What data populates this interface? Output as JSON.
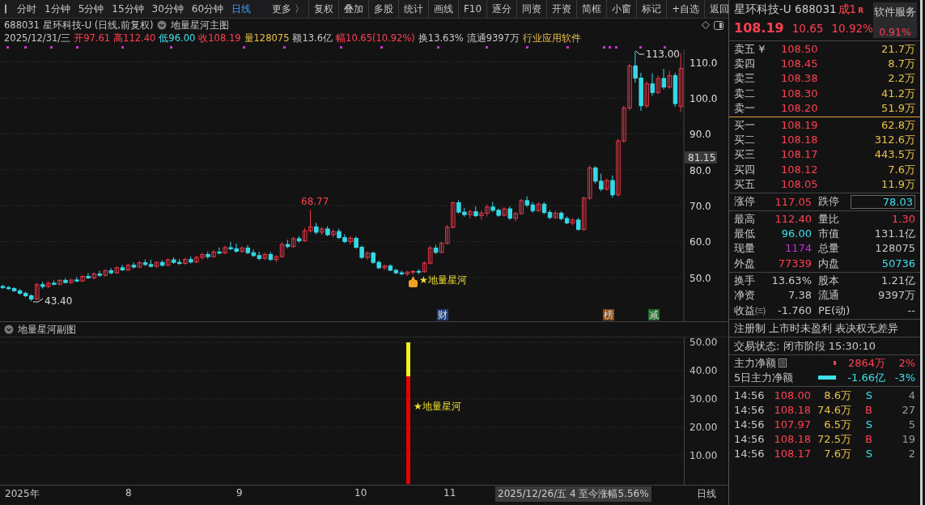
{
  "toolbar": {
    "period_tabs": [
      {
        "label": "分时",
        "selected": false
      },
      {
        "label": "1分钟",
        "selected": false
      },
      {
        "label": "5分钟",
        "selected": false
      },
      {
        "label": "15分钟",
        "selected": false
      },
      {
        "label": "30分钟",
        "selected": false
      },
      {
        "label": "60分钟",
        "selected": false
      },
      {
        "label": "日线",
        "selected": true
      },
      {
        "label": "更多 〉",
        "selected": false
      }
    ],
    "buttons": [
      "复权",
      "叠加",
      "多股",
      "统计",
      "画线",
      "F10",
      "逐分",
      "同资",
      "开资",
      "简框",
      "小窗",
      "标记",
      "+自选",
      "返回"
    ]
  },
  "header": {
    "title": "688031 星环科技-U (日线,前复权)",
    "indicator": "地量星河主图",
    "date": "2025/12/31/三",
    "quotes": [
      {
        "text": "开97.61",
        "kind": "up"
      },
      {
        "text": "高112.40",
        "kind": "up"
      },
      {
        "text": "低96.00",
        "kind": "down"
      },
      {
        "text": "收108.19",
        "kind": "up"
      },
      {
        "text": "量128075",
        "kind": "volume"
      },
      {
        "text": "额13.6亿",
        "kind": "plain"
      },
      {
        "text": "幅10.65(10.92%)",
        "kind": "up"
      },
      {
        "text": "换13.63%",
        "kind": "plain"
      },
      {
        "text": "流通9397万",
        "kind": "plain"
      },
      {
        "text": "行业应用软件",
        "kind": "volume"
      }
    ]
  },
  "main_chart": {
    "chart_data": {
      "type": "candlestick",
      "ohlc": [
        [
          47.5,
          48.0,
          46.8,
          47.2
        ],
        [
          47.2,
          47.6,
          46.5,
          46.9
        ],
        [
          46.9,
          47.3,
          46.0,
          46.3
        ],
        [
          46.3,
          46.8,
          45.2,
          45.6
        ],
        [
          45.6,
          46.0,
          44.5,
          44.9
        ],
        [
          44.9,
          45.3,
          43.4,
          44.0
        ],
        [
          44.0,
          48.5,
          43.8,
          48.0
        ],
        [
          48.0,
          48.8,
          46.9,
          47.5
        ],
        [
          47.5,
          48.9,
          47.0,
          48.4
        ],
        [
          48.4,
          49.2,
          47.8,
          48.1
        ],
        [
          48.1,
          49.5,
          47.9,
          49.2
        ],
        [
          49.2,
          49.8,
          48.3,
          48.6
        ],
        [
          48.6,
          49.6,
          48.2,
          49.3
        ],
        [
          49.3,
          50.1,
          48.7,
          49.0
        ],
        [
          49.0,
          50.6,
          48.8,
          50.3
        ],
        [
          50.3,
          51.2,
          49.6,
          49.9
        ],
        [
          49.9,
          51.4,
          49.5,
          51.0
        ],
        [
          51.0,
          51.9,
          50.2,
          50.6
        ],
        [
          50.6,
          52.3,
          50.3,
          51.9
        ],
        [
          51.9,
          52.6,
          50.9,
          51.3
        ],
        [
          51.3,
          53.1,
          51.0,
          52.7
        ],
        [
          52.7,
          53.5,
          51.8,
          52.1
        ],
        [
          52.1,
          53.8,
          51.7,
          53.4
        ],
        [
          53.4,
          54.2,
          52.5,
          52.9
        ],
        [
          52.9,
          54.6,
          52.6,
          54.1
        ],
        [
          54.1,
          55.0,
          53.2,
          53.6
        ],
        [
          53.6,
          54.9,
          52.8,
          53.1
        ],
        [
          53.1,
          54.5,
          52.7,
          54.2
        ],
        [
          54.2,
          54.8,
          53.0,
          53.4
        ],
        [
          53.4,
          55.3,
          53.1,
          54.9
        ],
        [
          54.9,
          55.6,
          53.8,
          54.2
        ],
        [
          54.2,
          55.1,
          53.5,
          53.9
        ],
        [
          53.9,
          55.4,
          53.6,
          55.0
        ],
        [
          55.0,
          55.8,
          53.9,
          54.3
        ],
        [
          54.3,
          56.0,
          54.0,
          55.6
        ],
        [
          55.6,
          56.9,
          55.0,
          56.4
        ],
        [
          56.4,
          57.2,
          55.2,
          55.8
        ],
        [
          55.8,
          57.6,
          55.5,
          57.1
        ],
        [
          57.1,
          58.3,
          56.4,
          56.8
        ],
        [
          56.8,
          58.8,
          56.5,
          58.3
        ],
        [
          58.3,
          59.9,
          57.6,
          58.0
        ],
        [
          58.0,
          59.4,
          56.9,
          57.3
        ],
        [
          57.3,
          58.7,
          56.8,
          58.2
        ],
        [
          58.2,
          59.0,
          56.5,
          56.9
        ],
        [
          56.9,
          57.8,
          55.7,
          56.1
        ],
        [
          56.1,
          57.2,
          54.8,
          55.3
        ],
        [
          55.3,
          56.9,
          54.9,
          56.4
        ],
        [
          56.4,
          57.1,
          54.6,
          55.0
        ],
        [
          55.0,
          56.2,
          54.3,
          55.8
        ],
        [
          55.8,
          59.8,
          55.5,
          59.2
        ],
        [
          59.2,
          60.5,
          58.1,
          58.6
        ],
        [
          58.6,
          61.3,
          58.3,
          60.8
        ],
        [
          60.8,
          61.5,
          59.7,
          60.2
        ],
        [
          60.2,
          63.8,
          59.9,
          63.0
        ],
        [
          63.0,
          68.77,
          62.5,
          64.1
        ],
        [
          64.1,
          65.2,
          62.0,
          62.6
        ],
        [
          62.6,
          64.0,
          61.8,
          63.5
        ],
        [
          63.5,
          64.3,
          61.5,
          61.9
        ],
        [
          61.9,
          63.4,
          61.2,
          62.8
        ],
        [
          62.8,
          63.6,
          60.7,
          61.1
        ],
        [
          61.1,
          62.0,
          59.6,
          60.0
        ],
        [
          60.0,
          61.5,
          59.2,
          60.9
        ],
        [
          60.9,
          61.4,
          58.0,
          58.4
        ],
        [
          58.4,
          58.9,
          55.2,
          55.6
        ],
        [
          55.6,
          57.3,
          54.9,
          56.8
        ],
        [
          56.8,
          57.2,
          53.8,
          54.2
        ],
        [
          54.2,
          54.7,
          52.3,
          52.7
        ],
        [
          52.7,
          53.6,
          52.1,
          53.2
        ],
        [
          53.2,
          53.7,
          51.8,
          52.0
        ],
        [
          52.0,
          52.4,
          50.9,
          51.3
        ],
        [
          51.3,
          51.9,
          50.6,
          51.0
        ],
        [
          51.0,
          51.8,
          50.4,
          51.5
        ],
        [
          51.5,
          52.0,
          50.8,
          51.7
        ],
        [
          51.7,
          52.3,
          50.9,
          51.6
        ],
        [
          51.6,
          54.5,
          51.3,
          54.0
        ],
        [
          54.0,
          58.8,
          53.6,
          58.2
        ],
        [
          58.2,
          59.1,
          56.5,
          57.0
        ],
        [
          57.0,
          59.9,
          56.7,
          59.5
        ],
        [
          59.5,
          64.6,
          59.2,
          64.0
        ],
        [
          64.0,
          71.2,
          63.6,
          70.8
        ],
        [
          70.8,
          71.5,
          67.8,
          68.2
        ],
        [
          68.2,
          69.4,
          66.9,
          67.5
        ],
        [
          67.5,
          68.9,
          66.5,
          68.3
        ],
        [
          68.3,
          69.8,
          66.8,
          67.2
        ],
        [
          67.2,
          68.6,
          66.1,
          67.9
        ],
        [
          67.9,
          70.3,
          67.0,
          69.6
        ],
        [
          69.6,
          71.0,
          68.2,
          68.7
        ],
        [
          68.7,
          69.2,
          66.9,
          67.3
        ],
        [
          67.3,
          69.6,
          67.0,
          69.1
        ],
        [
          69.1,
          69.8,
          66.0,
          66.5
        ],
        [
          66.5,
          68.2,
          65.6,
          67.8
        ],
        [
          67.8,
          71.9,
          67.5,
          71.4
        ],
        [
          71.4,
          72.6,
          69.6,
          70.2
        ],
        [
          70.2,
          71.0,
          68.0,
          68.6
        ],
        [
          68.6,
          70.9,
          68.3,
          70.4
        ],
        [
          70.4,
          71.0,
          67.6,
          68.1
        ],
        [
          68.1,
          68.8,
          66.2,
          66.7
        ],
        [
          66.7,
          68.5,
          66.3,
          67.9
        ],
        [
          67.9,
          68.4,
          65.9,
          66.4
        ],
        [
          66.4,
          67.0,
          64.8,
          65.2
        ],
        [
          65.2,
          66.5,
          64.5,
          66.0
        ],
        [
          66.0,
          66.6,
          63.0,
          63.4
        ],
        [
          63.4,
          72.5,
          63.0,
          72.1
        ],
        [
          72.1,
          81.2,
          71.6,
          80.5
        ],
        [
          80.5,
          81.0,
          76.2,
          76.8
        ],
        [
          76.8,
          78.9,
          74.0,
          74.6
        ],
        [
          74.6,
          77.5,
          74.2,
          77.0
        ],
        [
          77.0,
          78.4,
          72.2,
          73.0
        ],
        [
          73.0,
          88.6,
          72.6,
          88.0
        ],
        [
          88.0,
          97.9,
          87.5,
          97.2
        ],
        [
          97.2,
          109.4,
          96.5,
          108.9
        ],
        [
          108.9,
          113.0,
          104.2,
          105.5
        ],
        [
          105.5,
          107.0,
          96.4,
          97.8
        ],
        [
          97.8,
          104.6,
          97.2,
          103.9
        ],
        [
          103.9,
          106.8,
          100.6,
          101.5
        ],
        [
          101.5,
          106.2,
          101.0,
          105.4
        ],
        [
          105.4,
          108.1,
          102.3,
          103.0
        ],
        [
          103.0,
          107.5,
          102.5,
          106.2
        ],
        [
          106.2,
          107.0,
          97.5,
          98.4
        ],
        [
          97.61,
          112.4,
          96.0,
          108.19
        ]
      ],
      "grid": true,
      "ylim": [
        37.8,
        113.5
      ],
      "yticks": [
        {
          "value": 110,
          "label": "110.0"
        },
        {
          "value": 100,
          "label": "100.0"
        },
        {
          "value": 90,
          "label": "90.0"
        },
        {
          "value": 80,
          "label": "80.0"
        },
        {
          "value": 70,
          "label": "70.0"
        },
        {
          "value": 60,
          "label": "60.0"
        },
        {
          "value": 50,
          "label": "50.0"
        }
      ]
    },
    "current_price": "81.15",
    "high_label": "113.00",
    "peak_label": "68.77",
    "low_label": "43.40",
    "signal_label": "★地量星河",
    "event_marks": [
      {
        "label": "财",
        "kind": "finance"
      },
      {
        "label": "榜",
        "kind": "ranking"
      },
      {
        "label": "减",
        "kind": "reduce"
      }
    ]
  },
  "sub_chart": {
    "title": "地量星河副图",
    "y_ticks": [
      "50.00",
      "40.00",
      "30.00",
      "20.00",
      "10.00"
    ],
    "signal_label": "★地量星河"
  },
  "x_axis": {
    "labels": [
      "2025年",
      "8",
      "9",
      "10",
      "11"
    ],
    "cursor_info": "2025/12/26/五 4 至今涨幅5.56%",
    "period": "日线"
  },
  "quote": {
    "name": "星环科技-U 688031",
    "badge": "成1",
    "badge_mark": "R",
    "sector": "软件服务",
    "sector_change": "0.91%",
    "price": "108.19",
    "change": "10.65",
    "change_pct": "10.92%"
  },
  "asks": [
    {
      "label": "卖五 ¥",
      "price": "108.50",
      "volume": "21.7万"
    },
    {
      "label": "卖四",
      "price": "108.45",
      "volume": "8.7万"
    },
    {
      "label": "卖三",
      "price": "108.38",
      "volume": "2.2万"
    },
    {
      "label": "卖二",
      "price": "108.30",
      "volume": "41.2万"
    },
    {
      "label": "卖一",
      "price": "108.20",
      "volume": "51.9万"
    }
  ],
  "bids": [
    {
      "label": "买一",
      "price": "108.19",
      "volume": "62.8万"
    },
    {
      "label": "买二",
      "price": "108.18",
      "volume": "312.6万"
    },
    {
      "label": "买三",
      "price": "108.17",
      "volume": "443.5万"
    },
    {
      "label": "买四",
      "price": "108.12",
      "volume": "7.6万"
    },
    {
      "label": "买五",
      "price": "108.05",
      "volume": "11.9万"
    }
  ],
  "limits": {
    "up_label": "涨停",
    "up_value": "117.05",
    "down_label": "跌停",
    "down_value": "78.03"
  },
  "stats": [
    {
      "label": "最高",
      "value": "112.40",
      "kind": "up"
    },
    {
      "label": "量比",
      "value": "1.30",
      "kind": "up"
    },
    {
      "label": "最低",
      "value": "96.00",
      "kind": "down"
    },
    {
      "label": "市值",
      "value": "131.1亿",
      "kind": "plain"
    },
    {
      "label": "现量",
      "value": "1174",
      "kind": "trade"
    },
    {
      "label": "总量",
      "value": "128075",
      "kind": "plain"
    },
    {
      "label": "外盘",
      "value": "77339",
      "kind": "up"
    },
    {
      "label": "内盘",
      "value": "50736",
      "kind": "down"
    }
  ],
  "fundamentals": [
    {
      "label": "换手",
      "value": "13.63%",
      "kind": "plain"
    },
    {
      "label": "股本",
      "value": "1.21亿",
      "kind": "plain"
    },
    {
      "label": "净资",
      "value": "7.38",
      "kind": "plain"
    },
    {
      "label": "流通",
      "value": "9397万",
      "kind": "plain"
    },
    {
      "label": "收益㈢",
      "value": "-1.760",
      "kind": "plain"
    },
    {
      "label": "PE(动)",
      "value": "--",
      "kind": "plain"
    }
  ],
  "tags": "注册制 上市时未盈利 表决权无差异",
  "trade_status": "交易状态: 闭市阶段 15:30:10",
  "fund_flow": [
    {
      "label": "主力净额",
      "value": "2864万",
      "pct": "2%",
      "kind": "inflow"
    },
    {
      "label": "5日主力净额",
      "value": "-1.66亿",
      "pct": "-3%",
      "kind": "outflow"
    }
  ],
  "ticks": [
    {
      "time": "14:56",
      "price": "108.00",
      "volume": "8.6万",
      "side": "S",
      "kind": "sell",
      "count": "4"
    },
    {
      "time": "14:56",
      "price": "108.18",
      "volume": "74.6万",
      "side": "B",
      "kind": "buy",
      "count": "27"
    },
    {
      "time": "14:56",
      "price": "107.97",
      "volume": "6.5万",
      "side": "S",
      "kind": "sell",
      "count": "5"
    },
    {
      "time": "14:56",
      "price": "108.18",
      "volume": "72.5万",
      "side": "B",
      "kind": "buy",
      "count": "19"
    },
    {
      "time": "14:56",
      "price": "108.17",
      "volume": "7.6万",
      "side": "S",
      "kind": "sell",
      "count": "2"
    }
  ]
}
